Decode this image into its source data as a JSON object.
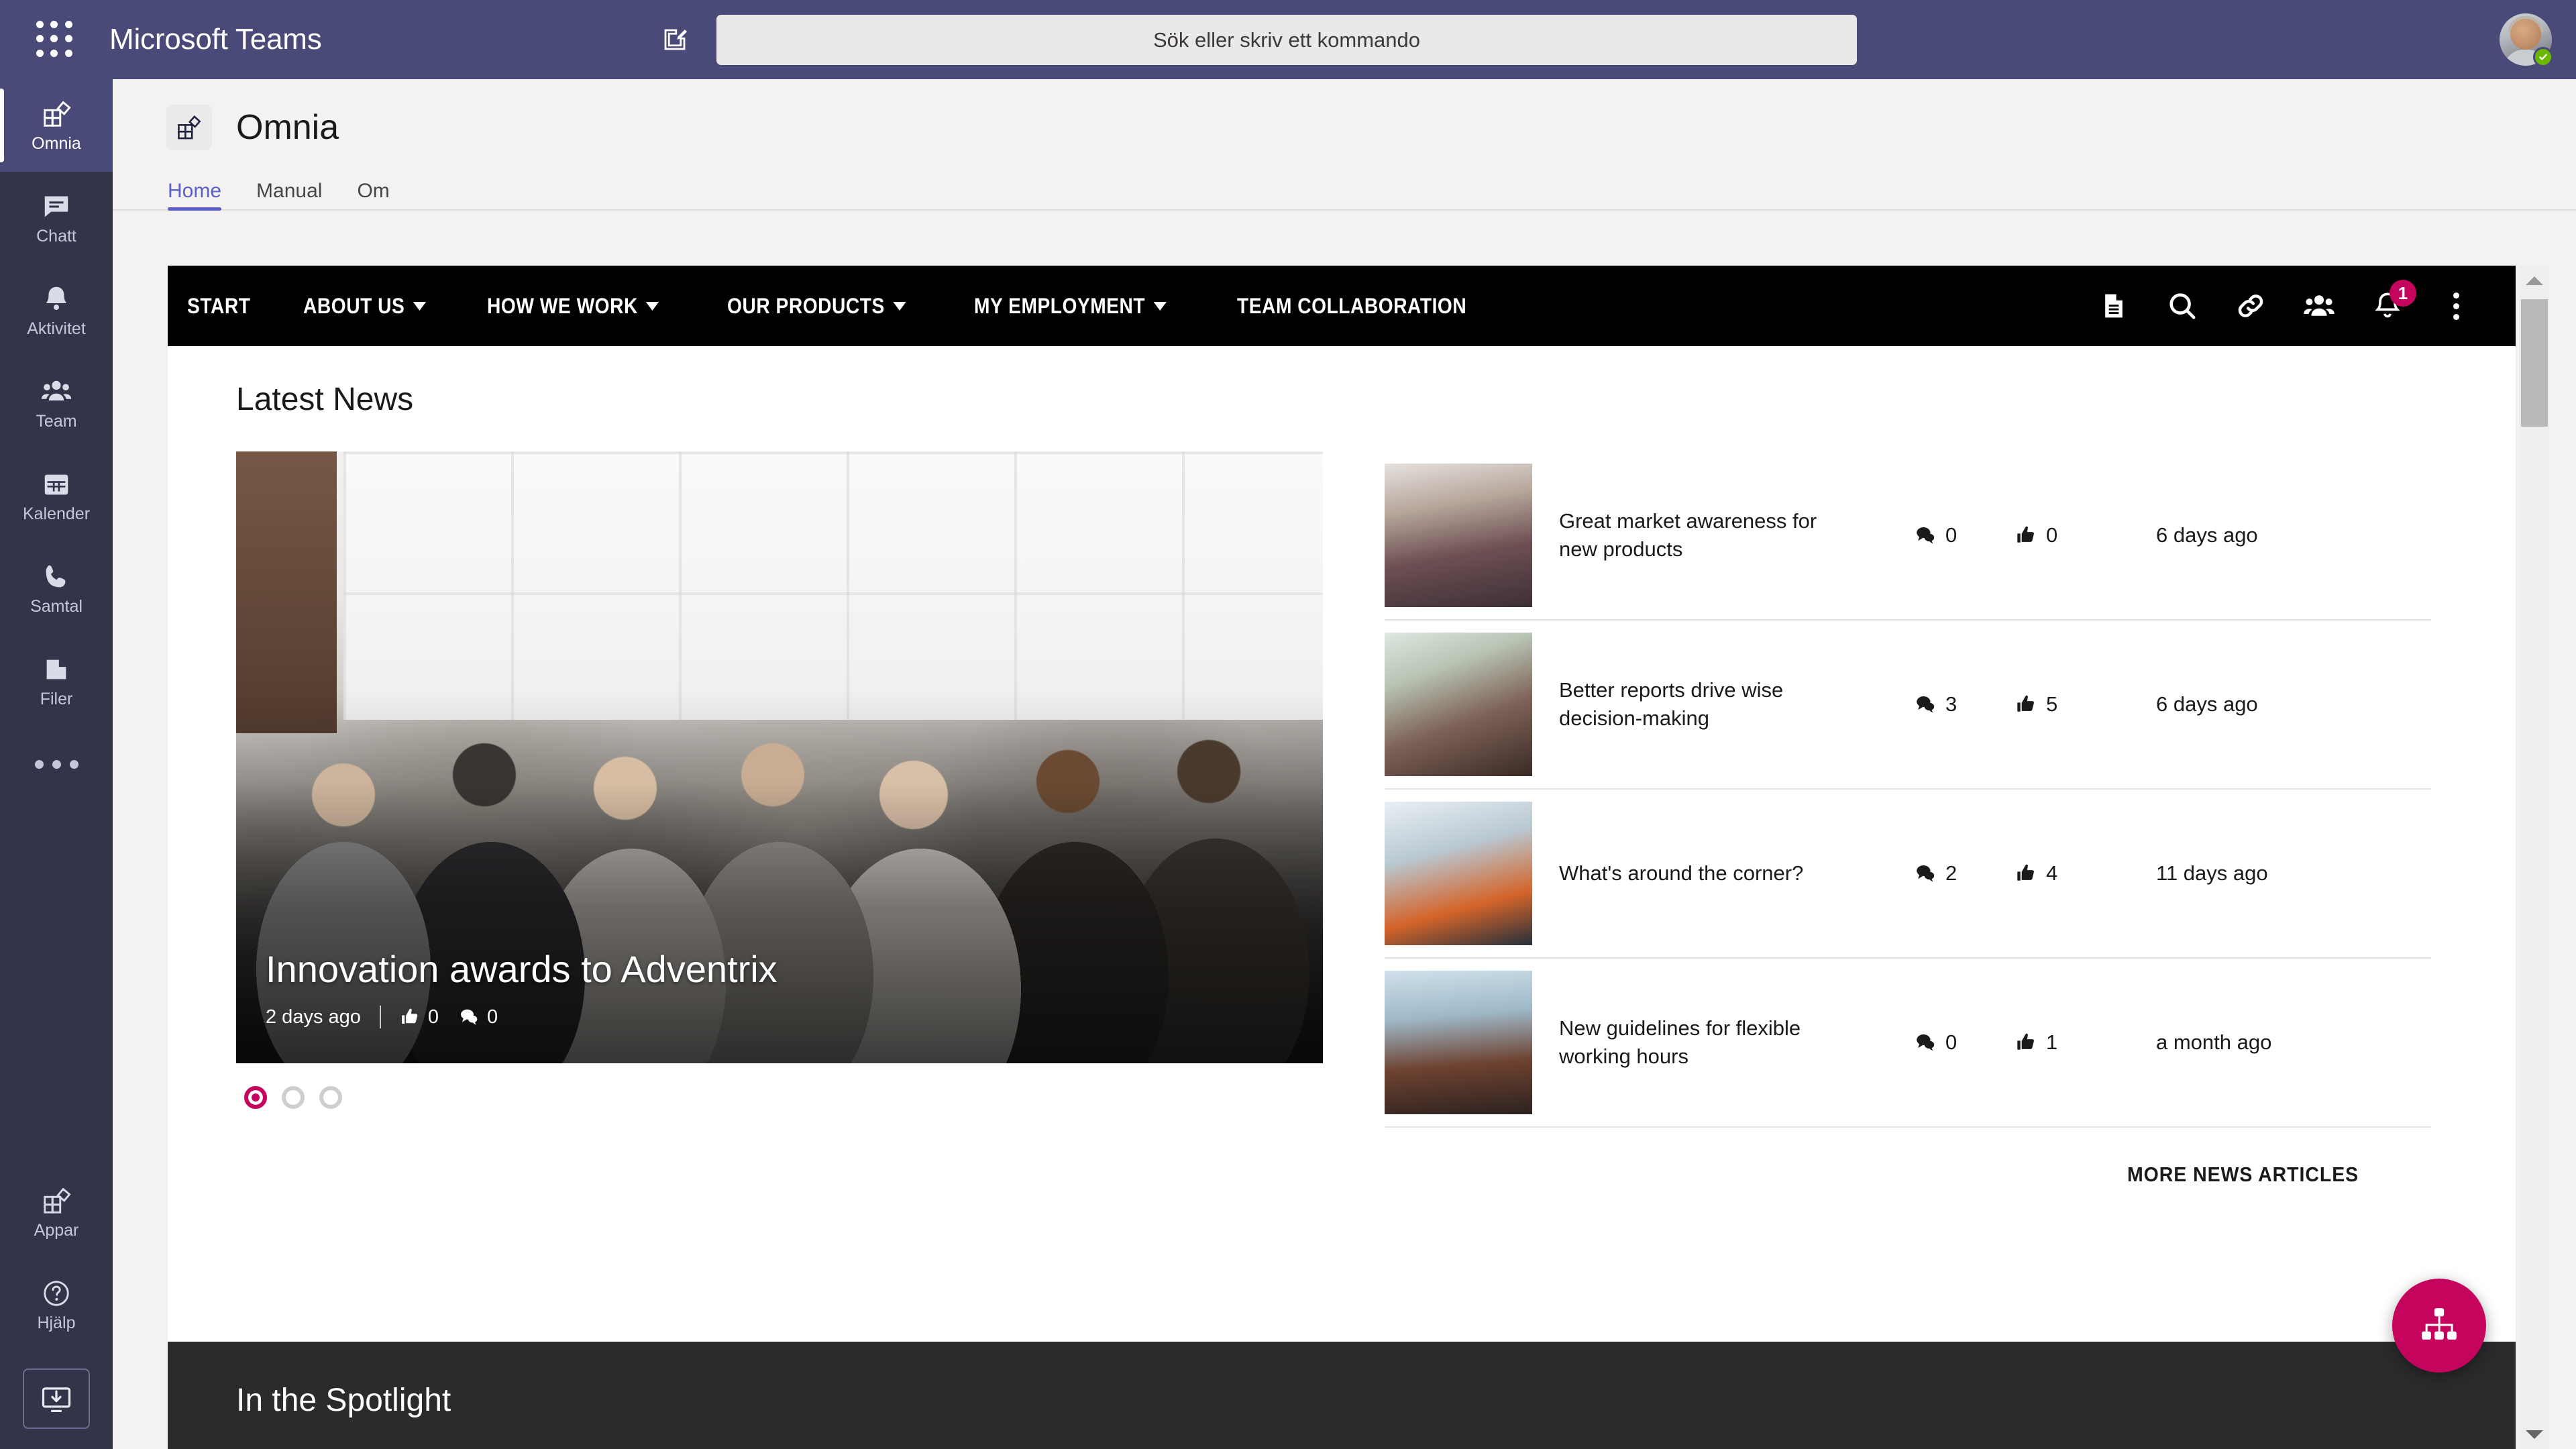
{
  "topbar": {
    "app_title": "Microsoft Teams",
    "waffle_icon": "app-launcher-icon",
    "compose_icon": "compose-pencil-icon",
    "search": {
      "placeholder": "Sök eller skriv ett kommando",
      "value": ""
    },
    "avatar_icon": "user-avatar",
    "presence": "available"
  },
  "rail": {
    "items": [
      {
        "label": "Omnia",
        "icon": "omnia-app-icon",
        "active": true
      },
      {
        "label": "Chatt",
        "icon": "chat-icon",
        "active": false
      },
      {
        "label": "Aktivitet",
        "icon": "bell-icon",
        "active": false
      },
      {
        "label": "Team",
        "icon": "people-icon",
        "active": false
      },
      {
        "label": "Kalender",
        "icon": "calendar-icon",
        "active": false
      },
      {
        "label": "Samtal",
        "icon": "phone-icon",
        "active": false
      },
      {
        "label": "Filer",
        "icon": "files-icon",
        "active": false
      }
    ],
    "more_icon": "more-dots-icon",
    "bottom": [
      {
        "label": "Appar",
        "icon": "apps-icon"
      },
      {
        "label": "Hjälp",
        "icon": "help-question-icon"
      }
    ],
    "get_app_icon": "download-desktop-app-icon"
  },
  "app_header": {
    "logo_icon": "omnia-app-icon",
    "title": "Omnia",
    "tabs": [
      {
        "label": "Home",
        "active": true
      },
      {
        "label": "Manual",
        "active": false
      },
      {
        "label": "Om",
        "active": false
      }
    ]
  },
  "sitenav": {
    "links": [
      {
        "label": "START",
        "has_dropdown": false
      },
      {
        "label": "ABOUT US",
        "has_dropdown": true
      },
      {
        "label": "HOW WE WORK",
        "has_dropdown": true
      },
      {
        "label": "OUR PRODUCTS",
        "has_dropdown": true
      },
      {
        "label": "MY EMPLOYMENT",
        "has_dropdown": true
      },
      {
        "label": "TEAM COLLABORATION",
        "has_dropdown": false
      }
    ],
    "icons": [
      {
        "name": "document-icon"
      },
      {
        "name": "search-icon"
      },
      {
        "name": "link-icon"
      },
      {
        "name": "people-icon"
      },
      {
        "name": "notification-bell-icon",
        "badge": "1"
      },
      {
        "name": "more-vertical-icon"
      }
    ],
    "badge_color": "#c5045e"
  },
  "news": {
    "heading": "Latest News",
    "hero": {
      "title": "Innovation awards to Adventrix",
      "date": "2 days ago",
      "likes": "0",
      "comments": "0",
      "like_icon": "thumbs-up-icon",
      "comment_icon": "comment-icon"
    },
    "carousel_dots": [
      {
        "active": true
      },
      {
        "active": false
      },
      {
        "active": false
      }
    ],
    "items": [
      {
        "title": "Great market awareness for new products",
        "comments": "0",
        "likes": "0",
        "date": "6 days ago",
        "thumb": "news-thumbnail-group-of-people"
      },
      {
        "title": "Better reports drive wise decision-making",
        "comments": "3",
        "likes": "5",
        "date": "6 days ago",
        "thumb": "news-thumbnail-two-women-laptop"
      },
      {
        "title": "What's around the corner?",
        "comments": "2",
        "likes": "4",
        "date": "11 days ago",
        "thumb": "news-thumbnail-two-men-laptop"
      },
      {
        "title": "New guidelines for flexible working hours",
        "comments": "0",
        "likes": "1",
        "date": "a month ago",
        "thumb": "news-thumbnail-man-with-map"
      }
    ],
    "more_link": "MORE NEWS ARTICLES"
  },
  "spotlight": {
    "heading": "In the Spotlight"
  },
  "fab": {
    "icon": "org-chart-icon",
    "color": "#c5045e"
  },
  "scrollbar": {
    "up_icon": "scroll-up-arrow",
    "down_icon": "scroll-down-arrow"
  }
}
